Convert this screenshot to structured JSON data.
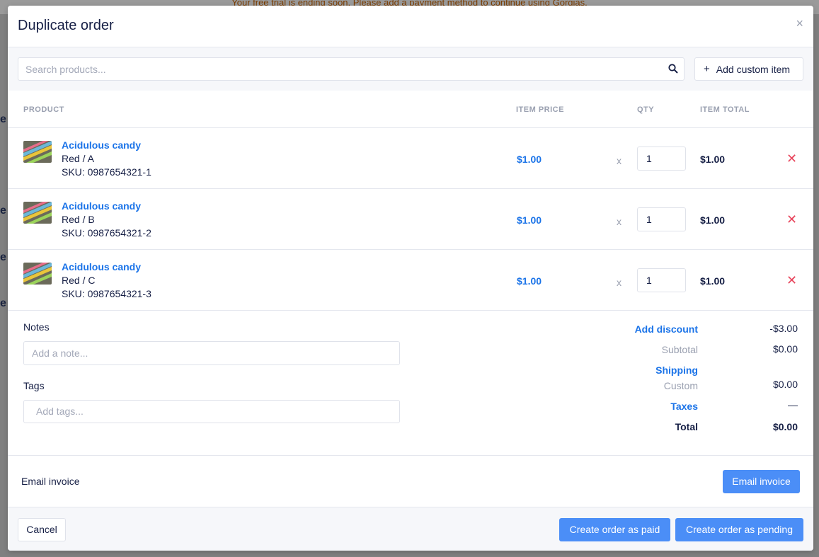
{
  "background": {
    "banner_text": "Your free trial is ending soon. Please add a payment method to continue using Gorgias."
  },
  "modal": {
    "title": "Duplicate order",
    "close_glyph": "×"
  },
  "search": {
    "placeholder": "Search products...",
    "add_custom_label": "Add custom item",
    "add_custom_glyph": "+"
  },
  "table": {
    "headers": {
      "product": "PRODUCT",
      "item_price": "ITEM PRICE",
      "qty": "QTY",
      "item_total": "ITEM TOTAL"
    },
    "multiply_glyph": "x",
    "remove_glyph": "✕",
    "rows": [
      {
        "name": "Acidulous candy",
        "variant": "Red / A",
        "sku": "SKU: 0987654321-1",
        "price": "$1.00",
        "qty": "1",
        "total": "$1.00"
      },
      {
        "name": "Acidulous candy",
        "variant": "Red / B",
        "sku": "SKU: 0987654321-2",
        "price": "$1.00",
        "qty": "1",
        "total": "$1.00"
      },
      {
        "name": "Acidulous candy",
        "variant": "Red / C",
        "sku": "SKU: 0987654321-3",
        "price": "$1.00",
        "qty": "1",
        "total": "$1.00"
      }
    ]
  },
  "notes": {
    "label": "Notes",
    "placeholder": "Add a note..."
  },
  "tags": {
    "label": "Tags",
    "placeholder": "Add tags..."
  },
  "summary": {
    "discount_label": "Add discount",
    "discount_value": "-$3.00",
    "subtotal_label": "Subtotal",
    "subtotal_value": "$0.00",
    "shipping_label": "Shipping",
    "shipping_method": "Custom",
    "shipping_value": "$0.00",
    "taxes_label": "Taxes",
    "taxes_value": "—",
    "total_label": "Total",
    "total_value": "$0.00"
  },
  "email": {
    "label": "Email invoice",
    "button_label": "Email invoice"
  },
  "footer": {
    "cancel_label": "Cancel",
    "paid_label": "Create order as paid",
    "pending_label": "Create order as pending"
  },
  "colors": {
    "accent": "#1a73e8",
    "primary_button": "#4b8ef7",
    "danger": "#e8465d",
    "text": "#161f45"
  }
}
